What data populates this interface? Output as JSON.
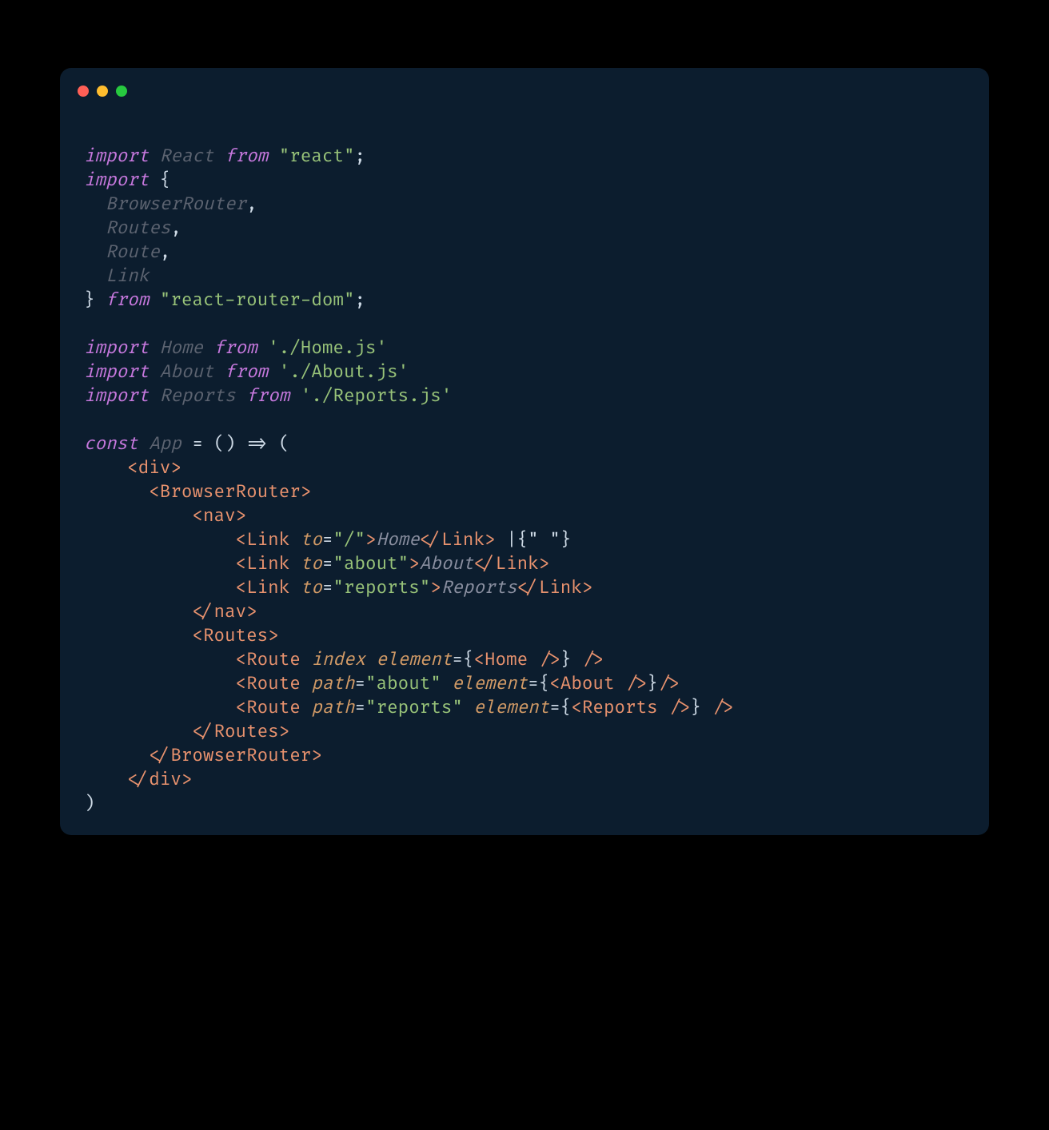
{
  "titlebar": {
    "dots": [
      "red",
      "yellow",
      "green"
    ]
  },
  "code": {
    "line1": {
      "a": "import",
      "b": "React",
      "c": "from",
      "d": "\"react\"",
      "e": ";"
    },
    "line2": {
      "a": "import",
      "b": "{"
    },
    "line3": {
      "a": "BrowserRouter",
      "b": ","
    },
    "line4": {
      "a": "Routes",
      "b": ","
    },
    "line5": {
      "a": "Route",
      "b": ","
    },
    "line6": {
      "a": "Link"
    },
    "line7": {
      "a": "}",
      "b": "from",
      "c": "\"react-router-dom\"",
      "d": ";"
    },
    "line8": "",
    "line9": {
      "a": "import",
      "b": "Home",
      "c": "from",
      "d": "'./Home.js'"
    },
    "line10": {
      "a": "import",
      "b": "About",
      "c": "from",
      "d": "'./About.js'"
    },
    "line11": {
      "a": "import",
      "b": "Reports",
      "c": "from",
      "d": "'./Reports.js'"
    },
    "line12": "",
    "line13": {
      "a": "const",
      "b": "App",
      "c": "= () => ("
    },
    "line14": {
      "open": "<",
      "name": "div",
      "close": ">"
    },
    "line15": {
      "open": "<",
      "name": "BrowserRouter",
      "close": ">"
    },
    "line16": {
      "open": "<",
      "name": "nav",
      "close": ">"
    },
    "line17": {
      "open": "<",
      "name": "Link",
      "attr": "to",
      "eq": "=",
      "val": "\"/\"",
      "close1": ">",
      "child": "Home",
      "open2": "</",
      "name2": "Link",
      "close2": ">",
      "tail": " |{\" \"}"
    },
    "line18": {
      "open": "<",
      "name": "Link",
      "attr": "to",
      "eq": "=",
      "val": "\"about\"",
      "close1": ">",
      "child": "About",
      "open2": "</",
      "name2": "Link",
      "close2": ">"
    },
    "line19": {
      "open": "<",
      "name": "Link",
      "attr": "to",
      "eq": "=",
      "val": "\"reports\"",
      "close1": ">",
      "child": "Reports",
      "open2": "</",
      "name2": "Link",
      "close2": ">"
    },
    "line20": {
      "open": "</",
      "name": "nav",
      "close": ">"
    },
    "line21": {
      "open": "<",
      "name": "Routes",
      "close": ">"
    },
    "line22": {
      "open": "<",
      "name": "Route",
      "attr1": "index",
      "attr2": "element",
      "eq": "=",
      "b1": "{",
      "open2": "<",
      "cmp": "Home",
      "selfclose": " />",
      "b2": "}",
      "tail": " />"
    },
    "line23": {
      "open": "<",
      "name": "Route",
      "attr1": "path",
      "eq1": "=",
      "val1": "\"about\"",
      "attr2": "element",
      "eq2": "=",
      "b1": "{",
      "open2": "<",
      "cmp": "About",
      "selfclose": " />",
      "b2": "}",
      "tail": "/>"
    },
    "line24": {
      "open": "<",
      "name": "Route",
      "attr1": "path",
      "eq1": "=",
      "val1": "\"reports\"",
      "attr2": "element",
      "eq2": "=",
      "b1": "{",
      "open2": "<",
      "cmp": "Reports",
      "selfclose": " />",
      "b2": "}",
      "tail": " />"
    },
    "line25": {
      "open": "</",
      "name": "Routes",
      "close": ">"
    },
    "line26": {
      "open": "</",
      "name": "BrowserRouter",
      "close": ">"
    },
    "line27": {
      "open": "</",
      "name": "div",
      "close": ">"
    },
    "line28": {
      "a": ")"
    }
  }
}
